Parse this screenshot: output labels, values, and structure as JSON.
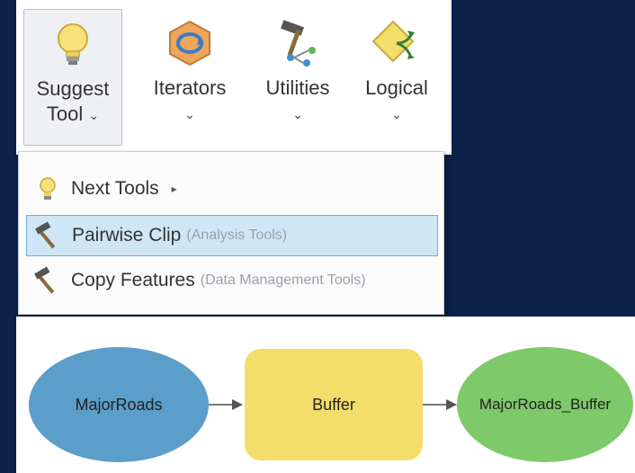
{
  "ribbon": {
    "buttons": [
      {
        "label_line1": "Suggest",
        "label_line2": "Tool",
        "icon": "lightbulb-icon"
      },
      {
        "label_line1": "Iterators",
        "label_line2": "",
        "icon": "iterator-icon"
      },
      {
        "label_line1": "Utilities",
        "label_line2": "",
        "icon": "hammer-icon"
      },
      {
        "label_line1": "Logical",
        "label_line2": "",
        "icon": "logical-diamond-icon"
      }
    ],
    "chevron": "⌄"
  },
  "menu": {
    "items": [
      {
        "label": "Next Tools",
        "sub": "",
        "icon": "lightbulb-icon",
        "has_submenu": true
      },
      {
        "label": "Pairwise Clip",
        "sub": "(Analysis Tools)",
        "icon": "hammer-icon",
        "highlighted": true
      },
      {
        "label": "Copy Features",
        "sub": "(Data Management Tools)",
        "icon": "hammer-icon"
      }
    ],
    "submenu_arrow": "▸"
  },
  "model": {
    "nodes": [
      {
        "label": "MajorRoads",
        "shape": "ellipse",
        "color": "#5b9ec9"
      },
      {
        "label": "Buffer",
        "shape": "rounded-rect",
        "color": "#f3dd6b"
      },
      {
        "label": "MajorRoads_Buffer",
        "shape": "ellipse",
        "color": "#7ec96a"
      }
    ]
  },
  "colors": {
    "background": "#0b2148",
    "highlight": "#cfe6f6",
    "highlight_border": "#6aaedb"
  }
}
